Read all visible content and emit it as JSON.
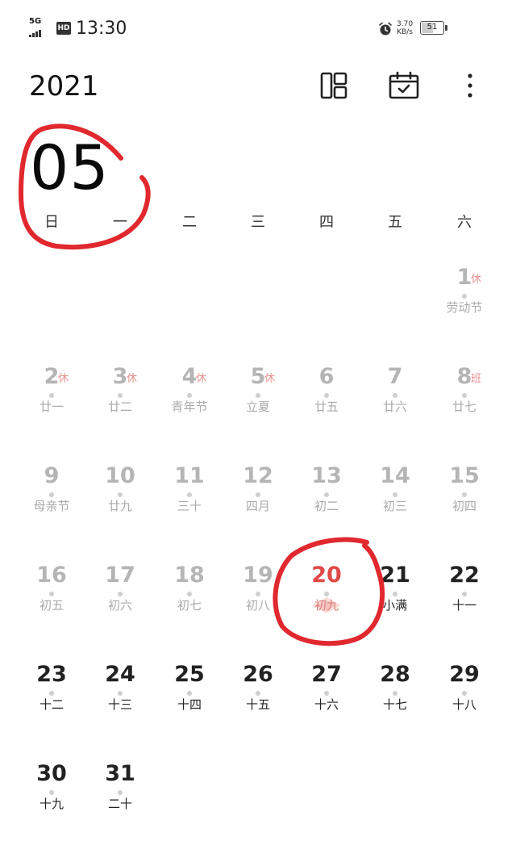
{
  "status_bar": {
    "network": "5G",
    "hd": "HD",
    "time": "13:30",
    "speed_value": "3.70",
    "speed_unit": "KB/s",
    "battery": "51"
  },
  "header": {
    "year": "2021",
    "month": "05",
    "layout_icon": "layout-grid-icon",
    "today_icon": "calendar-check-icon",
    "more_icon": "more-vert-icon"
  },
  "weekdays": [
    "日",
    "一",
    "二",
    "三",
    "四",
    "五",
    "六"
  ],
  "days": [
    {
      "n": "1",
      "sub": "劳动节",
      "tag": "休"
    },
    {
      "n": "2",
      "sub": "廿一",
      "tag": "休"
    },
    {
      "n": "3",
      "sub": "廿二",
      "tag": "休"
    },
    {
      "n": "4",
      "sub": "青年节",
      "tag": "休"
    },
    {
      "n": "5",
      "sub": "立夏",
      "tag": "休"
    },
    {
      "n": "6",
      "sub": "廿五"
    },
    {
      "n": "7",
      "sub": "廿六"
    },
    {
      "n": "8",
      "sub": "廿七",
      "tag": "班"
    },
    {
      "n": "9",
      "sub": "母亲节"
    },
    {
      "n": "10",
      "sub": "廿九"
    },
    {
      "n": "11",
      "sub": "三十"
    },
    {
      "n": "12",
      "sub": "四月"
    },
    {
      "n": "13",
      "sub": "初二"
    },
    {
      "n": "14",
      "sub": "初三"
    },
    {
      "n": "15",
      "sub": "初四"
    },
    {
      "n": "16",
      "sub": "初五"
    },
    {
      "n": "17",
      "sub": "初六"
    },
    {
      "n": "18",
      "sub": "初七"
    },
    {
      "n": "19",
      "sub": "初八"
    },
    {
      "n": "20",
      "sub": "初九",
      "today": true
    },
    {
      "n": "21",
      "sub": "小满"
    },
    {
      "n": "22",
      "sub": "十一"
    },
    {
      "n": "23",
      "sub": "十二"
    },
    {
      "n": "24",
      "sub": "十三"
    },
    {
      "n": "25",
      "sub": "十四"
    },
    {
      "n": "26",
      "sub": "十五"
    },
    {
      "n": "27",
      "sub": "十六"
    },
    {
      "n": "28",
      "sub": "十七"
    },
    {
      "n": "29",
      "sub": "十八"
    },
    {
      "n": "30",
      "sub": "十九"
    },
    {
      "n": "31",
      "sub": "二十"
    }
  ],
  "colors": {
    "today": "#e04848",
    "holiday_tag": "#e8938f",
    "past_text": "#b5b5b5",
    "annotation": "#e0282e"
  }
}
